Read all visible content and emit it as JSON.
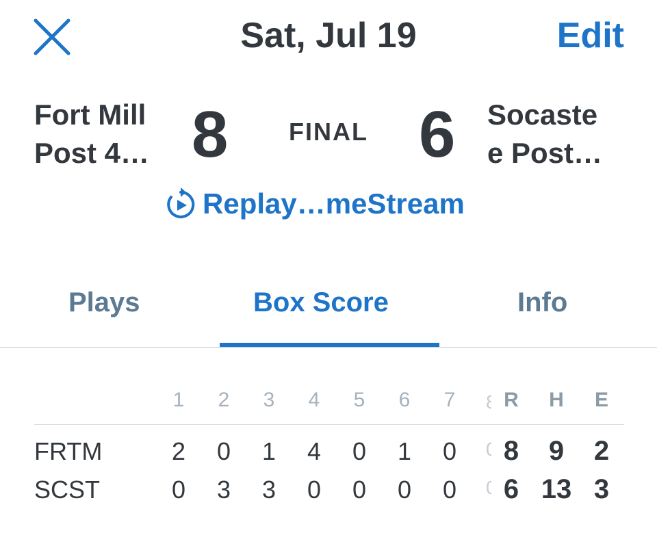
{
  "header": {
    "title": "Sat, Jul 19",
    "edit_label": "Edit",
    "close_icon": "close-icon"
  },
  "game": {
    "home_team": "Fort Mill\nPost 4…",
    "away_team": "Socaste\ne Post…",
    "home_score": "8",
    "away_score": "6",
    "status": "FINAL",
    "replay_label": "Replay…meStream",
    "replay_icon": "replay-icon"
  },
  "tabs": [
    {
      "label": "Plays",
      "active": false
    },
    {
      "label": "Box Score",
      "active": true
    },
    {
      "label": "Info",
      "active": false
    }
  ],
  "box_score": {
    "innings": [
      "1",
      "2",
      "3",
      "4",
      "5",
      "6",
      "7"
    ],
    "totals_headers": [
      "R",
      "H",
      "E"
    ],
    "rows": [
      {
        "team": "FRTM",
        "innings": [
          "2",
          "0",
          "1",
          "4",
          "0",
          "1",
          "0"
        ],
        "R": "8",
        "H": "9",
        "E": "2"
      },
      {
        "team": "SCST",
        "innings": [
          "0",
          "3",
          "3",
          "0",
          "0",
          "0",
          "0"
        ],
        "R": "6",
        "H": "13",
        "E": "3"
      }
    ]
  },
  "colors": {
    "accent": "#1d74c8",
    "text": "#33383e",
    "tab_inactive": "#5c7a92",
    "header_muted": "#a6b2bc"
  }
}
